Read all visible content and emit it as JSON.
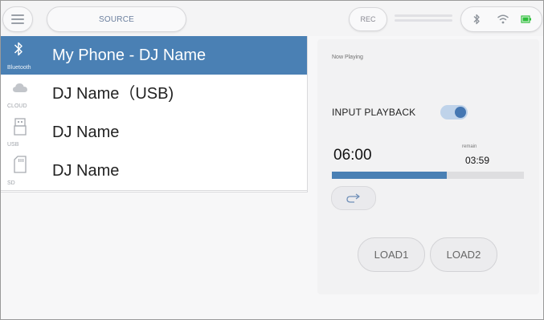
{
  "topbar": {
    "menu_icon": "hamburger-menu-icon",
    "source_label": "SOURCE",
    "rec_label": "REC",
    "status_icons": [
      "bluetooth-icon",
      "wifi-icon",
      "battery-icon"
    ],
    "accent_color": "#4a80b4",
    "battery_color": "#2dbf3a"
  },
  "sources": [
    {
      "icon": "bluetooth-icon",
      "caption": "Bluetooth",
      "name": "My Phone - DJ Name",
      "selected": true
    },
    {
      "icon": "cloud-icon",
      "caption": "CLOUD",
      "name": "DJ Name（USB)",
      "selected": false
    },
    {
      "icon": "usb-icon",
      "caption": "USB",
      "name": "DJ Name",
      "selected": false
    },
    {
      "icon": "sd-card-icon",
      "caption": "SD",
      "name": "DJ Name",
      "selected": false
    }
  ],
  "now_playing": {
    "title": "Now Playing",
    "input_playback_label": "INPUT PLAYBACK",
    "input_playback_on": true,
    "elapsed": "06:00",
    "remain_label": "remain",
    "remain": "03:59",
    "progress": 0.6,
    "loop_icon": "loop-arrow-icon",
    "load1_label": "LOAD1",
    "load2_label": "LOAD2"
  }
}
